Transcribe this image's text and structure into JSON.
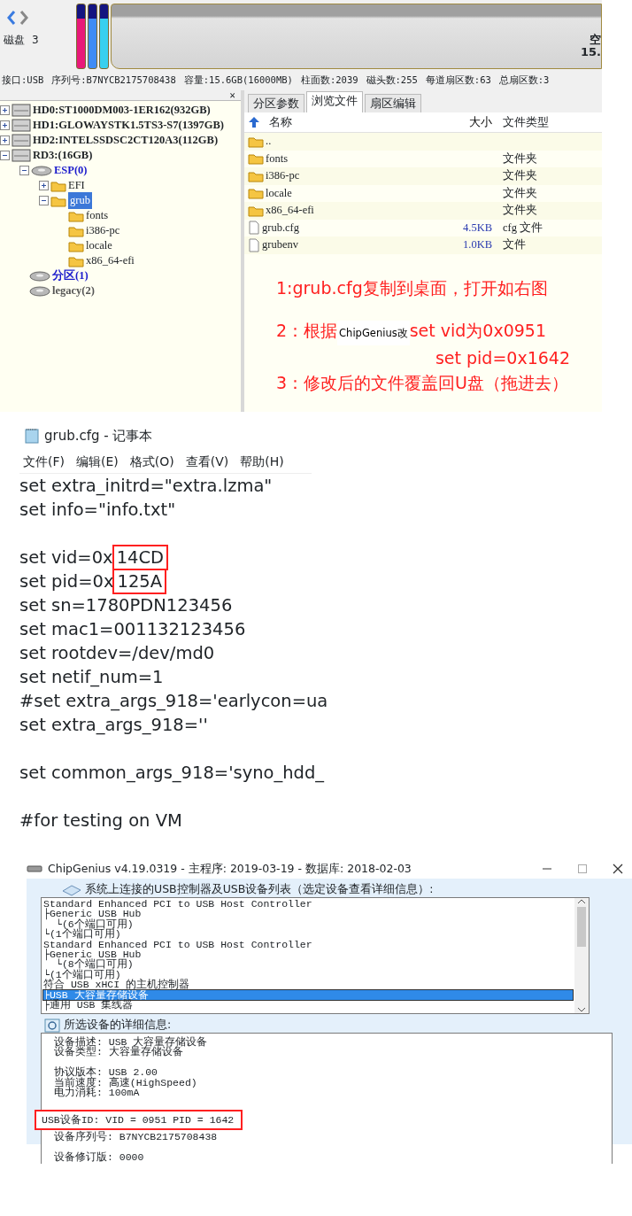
{
  "disk_tool": {
    "disk_label": "磁盘",
    "disk_number": "3",
    "partition_bars": [
      {
        "color": "#e8197a"
      },
      {
        "color": "#3f8cf5"
      },
      {
        "color": "#38d0f0"
      }
    ],
    "free_label": "空",
    "free_size": "15.",
    "tree_close": "×",
    "info": [
      "接口:USB",
      "序列号:B7NYCB2175708438",
      "容量:15.6GB(16000MB)",
      "柱面数:2039",
      "磁头数:255",
      "每道扇区数:63",
      "总扇区数:3"
    ],
    "tree": [
      {
        "kind": "disk",
        "label": "HD0:ST1000DM003-1ER162(932GB)",
        "expanded": false,
        "selected": false
      },
      {
        "kind": "disk",
        "label": "HD1:GLOWAYSTK1.5TS3-S7(1397GB)",
        "expanded": false,
        "selected": false
      },
      {
        "kind": "disk",
        "label": "HD2:INTELSSDSC2CT120A3(112GB)",
        "expanded": false,
        "selected": false
      },
      {
        "kind": "disk",
        "label": "RD3:(16GB)",
        "expanded": true,
        "selected": false,
        "children": [
          {
            "kind": "partition",
            "label": "ESP(0)",
            "color": "#1a1acc",
            "expanded": true,
            "selected": false,
            "children": [
              {
                "kind": "folder",
                "label": "EFI",
                "expanded": false,
                "selected": false
              },
              {
                "kind": "folder",
                "label": "grub",
                "expanded": true,
                "selected": true,
                "children": [
                  {
                    "kind": "folder",
                    "label": "fonts",
                    "selected": false
                  },
                  {
                    "kind": "folder",
                    "label": "i386-pc",
                    "selected": false
                  },
                  {
                    "kind": "folder",
                    "label": "locale",
                    "selected": false
                  },
                  {
                    "kind": "folder",
                    "label": "x86_64-efi",
                    "selected": false
                  }
                ]
              }
            ]
          },
          {
            "kind": "partition",
            "label": "分区(1)",
            "color": "#1a1acc",
            "selected": false
          },
          {
            "kind": "partition",
            "label": "legacy(2)",
            "color": "#555555",
            "selected": false
          }
        ]
      }
    ],
    "tabs": [
      {
        "label": "分区参数",
        "selected": false
      },
      {
        "label": "浏览文件",
        "selected": true
      },
      {
        "label": "扇区编辑",
        "selected": false
      }
    ],
    "columns": [
      "名称",
      "大小",
      "文件类型"
    ],
    "files": [
      {
        "kind": "parent",
        "name": ".."
      },
      {
        "kind": "folder",
        "name": "fonts",
        "type": "文件夹"
      },
      {
        "kind": "folder",
        "name": "i386-pc",
        "type": "文件夹"
      },
      {
        "kind": "folder",
        "name": "locale",
        "type": "文件夹"
      },
      {
        "kind": "folder",
        "name": "x86_64-efi",
        "type": "文件夹"
      },
      {
        "kind": "file",
        "name": "grub.cfg",
        "size": "4.5KB",
        "type": "cfg 文件"
      },
      {
        "kind": "file",
        "name": "grubenv",
        "size": "1.0KB",
        "type": "文件"
      }
    ],
    "annotations": [
      {
        "kind": "line",
        "segments": [
          {
            "kind": "normal",
            "text": "1:grub.cfg复制到桌面，打开如右图"
          }
        ]
      },
      {
        "kind": "line",
        "segments": [
          {
            "kind": "normal",
            "text": "2：根据"
          },
          {
            "kind": "small",
            "text": "ChipGenius改"
          },
          {
            "kind": "normal",
            "text": "set vid为0x0951"
          }
        ]
      },
      {
        "kind": "continuation",
        "segments": [
          {
            "kind": "normal",
            "text": "set pid=0x1642"
          }
        ]
      },
      {
        "kind": "line",
        "segments": [
          {
            "kind": "normal",
            "text": "3：修改后的文件覆盖回U盘（拖进去）"
          }
        ]
      }
    ]
  },
  "notepad": {
    "title": "grub.cfg - 记事本",
    "menu": [
      "文件(F)",
      "编辑(E)",
      "格式(O)",
      "查看(V)",
      "帮助(H)"
    ],
    "blocks": [
      [
        {
          "text": "set extra_initrd=\"extra.lzma\""
        },
        {
          "text": "set info=\"info.txt\""
        }
      ],
      [
        {
          "text": "set vid=0x",
          "boxed": "14CD"
        },
        {
          "text": "set pid=0x",
          "boxed": "125A"
        },
        {
          "text": "set sn=1780PDN123456"
        },
        {
          "text": "set mac1=001132123456"
        },
        {
          "text": "set rootdev=/dev/md0"
        },
        {
          "text": "set netif_num=1"
        },
        {
          "text": "#set extra_args_918='earlycon=ua"
        },
        {
          "text": "set extra_args_918=''"
        }
      ],
      [
        {
          "text": "set common_args_918='syno_hdd_"
        }
      ],
      [
        {
          "text": "#for testing on VM"
        }
      ]
    ]
  },
  "chipgenius": {
    "title": "ChipGenius v4.19.0319 - 主程序: 2019-03-19 - 数据库: 2018-02-03",
    "list_label": "系统上连接的USB控制器及USB设备列表（选定设备查看详细信息）:",
    "devices": [
      {
        "text": "Standard Enhanced PCI to USB Host Controller",
        "selected": false,
        "children": [
          {
            "text": "├Generic USB Hub",
            "selected": false,
            "children": [
              {
                "text": "└(6个端口可用)",
                "selected": false
              }
            ]
          },
          {
            "text": "└(1个端口可用)",
            "selected": false
          }
        ]
      },
      {
        "text": "Standard Enhanced PCI to USB Host Controller",
        "selected": false,
        "children": [
          {
            "text": "├Generic USB Hub",
            "selected": false,
            "children": [
              {
                "text": "└(8个端口可用)",
                "selected": false
              }
            ]
          },
          {
            "text": "└(1个端口可用)",
            "selected": false
          }
        ]
      },
      {
        "text": "符合 USB xHCI 的主机控制器",
        "selected": false,
        "children": [
          {
            "text": "├USB 大容量存储设备",
            "selected": true
          },
          {
            "text": "├通用 USB 集线器",
            "selected": false
          }
        ]
      }
    ],
    "detail_label": "所选设备的详细信息:",
    "detail_blocks": [
      [
        {
          "text": "设备描述: USB 大容量存储设备",
          "boxed": false
        },
        {
          "text": "设备类型: 大容量存储设备",
          "boxed": false
        }
      ],
      [
        {
          "text": "协议版本: USB 2.00",
          "boxed": false
        },
        {
          "text": "当前速度: 高速(HighSpeed)",
          "boxed": false
        },
        {
          "text": "电力消耗: 100mA",
          "boxed": false
        }
      ],
      [
        {
          "text": "USB设备ID: VID = 0951 PID = 1642",
          "boxed": true
        },
        {
          "text": "设备序列号: B7NYCB2175708438",
          "boxed": false
        }
      ],
      [
        {
          "text": "设备修订版: 0000",
          "boxed": false
        }
      ]
    ]
  }
}
